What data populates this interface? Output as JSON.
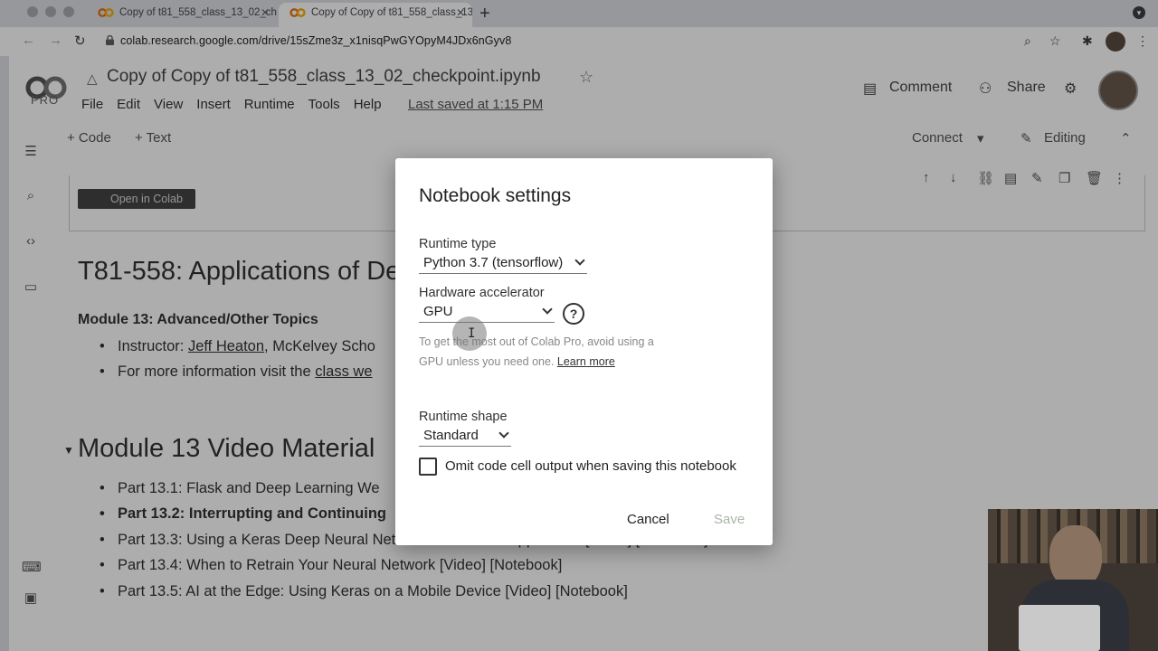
{
  "browser": {
    "tabs": [
      {
        "title": "Copy of t81_558_class_13_02_che",
        "active": false
      },
      {
        "title": "Copy of Copy of t81_558_class_13",
        "active": true
      }
    ],
    "url": "colab.research.google.com/drive/15sZme3z_x1nisqPwGYOpyM4JDx6nGyv8"
  },
  "colab": {
    "logo_badge": "PRO",
    "notebook_title": "Copy of Copy of t81_558_class_13_02_checkpoint.ipynb",
    "menu": [
      "File",
      "Edit",
      "View",
      "Insert",
      "Runtime",
      "Tools",
      "Help"
    ],
    "last_saved": "Last saved at 1:15 PM",
    "comment_label": "Comment",
    "share_label": "Share",
    "add_code": "+ Code",
    "add_text": "+ Text",
    "connect_label": "Connect",
    "editing_label": "Editing"
  },
  "notebook": {
    "open_in_colab": "Open in Colab",
    "heading": "T81-558: Applications of De",
    "module": "Module 13: Advanced/Other Topics",
    "bullets_top": [
      {
        "prefix": "Instructor: ",
        "link": "Jeff Heaton",
        "suffix": ", McKelvey Scho"
      },
      {
        "prefix": "For more information visit the ",
        "link": "class we",
        "suffix": ""
      }
    ],
    "section_heading": "Module 13 Video Material",
    "parts": [
      {
        "text": "Part 13.1: Flask and Deep Learning We",
        "bold": false
      },
      {
        "text": "Part 13.2: Interrupting and Continuing",
        "bold": true
      },
      {
        "text": "Part 13.3: Using a Keras Deep Neural Network with a Web Application [Video] [Notebook]",
        "bold": false
      },
      {
        "text": "Part 13.4: When to Retrain Your Neural Network [Video] [Notebook]",
        "bold": false
      },
      {
        "text": "Part 13.5: AI at the Edge: Using Keras on a Mobile Device [Video] [Notebook]",
        "bold": false
      }
    ]
  },
  "dialog": {
    "title": "Notebook settings",
    "runtime_type_label": "Runtime type",
    "runtime_type_value": "Python 3.7 (tensorflow)",
    "accelerator_label": "Hardware accelerator",
    "accelerator_value": "GPU",
    "hint_text": "To get the most out of Colab Pro, avoid using a GPU unless you need one.",
    "hint_link": "Learn more",
    "runtime_shape_label": "Runtime shape",
    "runtime_shape_value": "Standard",
    "omit_output_label": "Omit code cell output when saving this notebook",
    "omit_output_checked": false,
    "cancel_label": "Cancel",
    "save_label": "Save",
    "save_enabled": false
  },
  "colors": {
    "overlay": "#000000",
    "save_disabled": "#a8b6a8",
    "hint": "#888888"
  }
}
